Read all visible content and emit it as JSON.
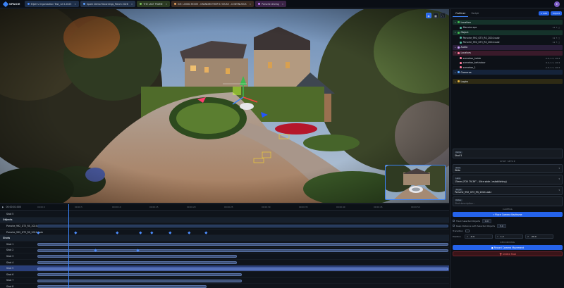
{
  "app": {
    "logo_text": "SPAXIE",
    "avatar_initial": "E"
  },
  "tabs": [
    {
      "label": "Elijah's Organization Test_12.5.2025",
      "color": "#4c8dff"
    },
    {
      "label": "Spark Demo Recordings_March 2026",
      "color": "#5aa0ff"
    },
    {
      "label": "THE LAST FRAME",
      "color": "#7fc15c"
    },
    {
      "label": "INT. LIVING ROOM - GRANDMOTHER'S HOUSE - CONTINUOUS",
      "color": "#e0a060"
    },
    {
      "label": "Porsche driving",
      "color": "#c27bff"
    }
  ],
  "viewport": {
    "toolbar_icons": [
      "camera-icon",
      "grid-icon",
      "fullscreen-icon"
    ]
  },
  "timeline": {
    "timecode": "00:00:01:000",
    "ticks": [
      "00:00:0",
      "00:00:5",
      "00:00:10",
      "00:00:15",
      "00:00:20",
      "00:00:25",
      "00:00:30",
      "00:00:35",
      "00:00:40",
      "00:00:45",
      "00:00:50",
      "00:00:55"
    ],
    "rows": [
      {
        "label": "Shot 5",
        "type": "item"
      },
      {
        "label": "Objects",
        "type": "group"
      },
      {
        "label": "Porsche_992_GT3_RS_2024.usdz",
        "type": "item"
      },
      {
        "label": "Porsche_992_GT3_RS_2024.usdz",
        "type": "item"
      },
      {
        "label": "Shots",
        "type": "group"
      },
      {
        "label": "Shot 1",
        "type": "item"
      },
      {
        "label": "Shot 2",
        "type": "item"
      },
      {
        "label": "Shot 3",
        "type": "item"
      },
      {
        "label": "Shot 4",
        "type": "item"
      },
      {
        "label": "Shot 5",
        "type": "item",
        "selected": true
      },
      {
        "label": "Shot 6",
        "type": "item"
      },
      {
        "label": "Shot 7",
        "type": "item"
      },
      {
        "label": "Shot 8",
        "type": "item"
      }
    ]
  },
  "panel": {
    "tabs": [
      "Outliner",
      "Script"
    ],
    "add_label": "+ Add",
    "import_label": "Import",
    "outliner": [
      {
        "section": "Location",
        "color": "#3fb950",
        "bg": "#15322a",
        "items": [
          {
            "name": "Mansion.spz",
            "val": "11 ↑ □"
          }
        ]
      },
      {
        "section": "Object",
        "color": "#3fb950",
        "bg": "#15322a",
        "items": [
          {
            "name": "Porsche_992_GT3_RS_2024.usdz",
            "val": "11 ↑ □"
          },
          {
            "name": "Porsche_992_GT3_RS_2024.usdz",
            "val": "11 ↑ □"
          }
        ]
      },
      {
        "section": "Audio",
        "color": "#d2a8ff",
        "bg": "#2a1f3a",
        "items": []
      },
      {
        "section": "Locators",
        "color": "#ff7b9c",
        "bg": "#3a1a2a",
        "items": [
          {
            "name": "scenetoo_inside",
            "val": "-1.0, 1.3, -10.4"
          },
          {
            "name": "scenetoo_behindcar",
            "val": "0.4, 1.1, -10.4"
          },
          {
            "name": "scenetoo_1",
            "val": "-1.0, 1.1, -10.4"
          }
        ]
      },
      {
        "section": "Cameras",
        "color": "#58a6ff",
        "bg": "#15233a",
        "items": []
      },
      {
        "section": "Logics",
        "color": "#e3b341",
        "bg": "#2e2a14",
        "items": []
      }
    ],
    "props": {
      "name_label": "Name",
      "name_value": "Shot 5",
      "shot_setup": "SHOT SETUP",
      "shot_label": "Shot",
      "shot_value": "Wide",
      "lens_label": "Lens",
      "lens_value": "15mm (FOV 79.39° - Ultra wide / establishing)",
      "target_label": "Target",
      "target_value": "Porsche_992_GT3_RS_2024.usdz",
      "desc_label": "Notes",
      "desc_placeholder": "Shot description...",
      "camera_title": "CAMERA",
      "place_keyframe": "⌖ Place Camera Keyframe",
      "track_selected": "Track Selected Objects",
      "track_chip": "0.0",
      "keep_distance": "Keep Distance with Selected Objects",
      "keep_chip": "5.0",
      "transition_label": "Transition",
      "position_label": "Position",
      "pos_x": "-6.9",
      "pos_y": "1.2",
      "pos_z": "-20.0",
      "recording_title": "RECORDING",
      "record_label": "● Record Camera Movement",
      "delete_label": "🗑 Delete Shot"
    }
  }
}
